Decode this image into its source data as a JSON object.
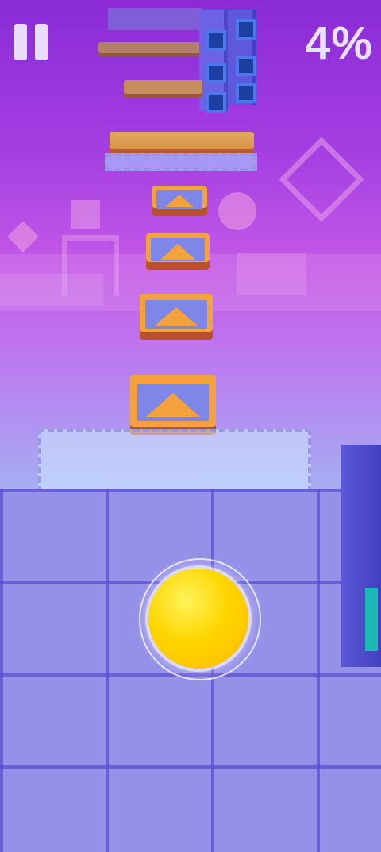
{
  "hud": {
    "progress_percent": "4%",
    "pause_icon": "pause-icon"
  },
  "colors": {
    "sky_top": "#8a2bd6",
    "sky_mid": "#c65ae8",
    "sky_bottom": "#bdf1f8",
    "ball": "#ffd500",
    "floor": "#9590e8",
    "pad": "#f4a23e",
    "platform": "#f08a2c"
  },
  "scene": {
    "ball": "ball-icon",
    "pads": [
      "triangle-pad",
      "triangle-pad",
      "triangle-pad",
      "triangle-pad"
    ],
    "platforms": [
      "platform",
      "platform",
      "platform",
      "platform"
    ]
  }
}
